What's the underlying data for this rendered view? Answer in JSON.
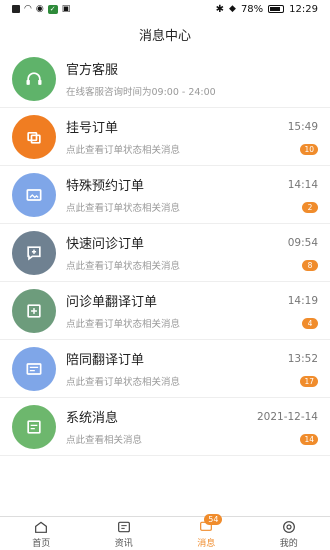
{
  "status": {
    "battery": "78%",
    "time": "12:29"
  },
  "header": {
    "title": "消息中心"
  },
  "messages": [
    {
      "title": "官方客服",
      "sub": "在线客服咨询时间为09:00 - 24:00",
      "time": "",
      "badge": "",
      "color": "#5fb36a",
      "icon": "headset-icon"
    },
    {
      "title": "挂号订单",
      "sub": "点此查看订单状态相关消息",
      "time": "15:49",
      "badge": "10",
      "color": "#f07d22",
      "icon": "registration-icon"
    },
    {
      "title": "特殊预约订单",
      "sub": "点此查看订单状态相关消息",
      "time": "14:14",
      "badge": "2",
      "color": "#7fa6e8",
      "icon": "appointment-icon"
    },
    {
      "title": "快速问诊订单",
      "sub": "点此查看订单状态相关消息",
      "time": "09:54",
      "badge": "8",
      "color": "#6f8191",
      "icon": "consult-icon"
    },
    {
      "title": "问诊单翻译订单",
      "sub": "点此查看订单状态相关消息",
      "time": "14:19",
      "badge": "4",
      "color": "#6d9c7c",
      "icon": "translate-order-icon"
    },
    {
      "title": "陪同翻译订单",
      "sub": "点此查看订单状态相关消息",
      "time": "13:52",
      "badge": "17",
      "color": "#7fa6e8",
      "icon": "escort-translate-icon"
    },
    {
      "title": "系统消息",
      "sub": "点此查看相关消息",
      "time": "2021-12-14",
      "badge": "14",
      "color": "#6db76d",
      "icon": "system-message-icon"
    }
  ],
  "tabs": [
    {
      "label": "首页",
      "icon": "home-icon",
      "active": false
    },
    {
      "label": "资讯",
      "icon": "news-icon",
      "active": false
    },
    {
      "label": "消息",
      "icon": "message-icon",
      "active": true,
      "badge": "54"
    },
    {
      "label": "我的",
      "icon": "profile-icon",
      "active": false
    }
  ]
}
